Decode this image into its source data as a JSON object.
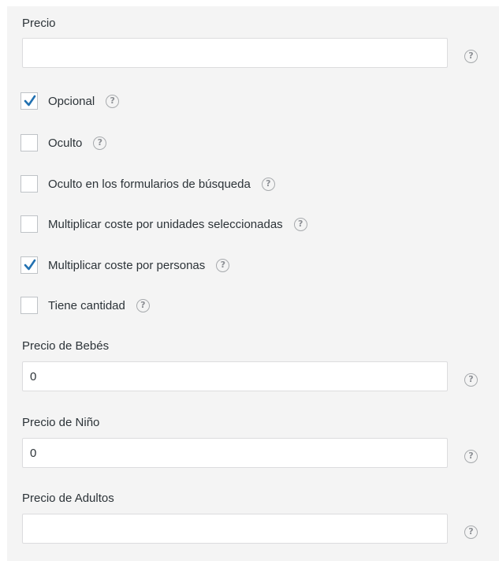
{
  "fields": {
    "precio": {
      "label": "Precio",
      "value": ""
    },
    "precio_bebes": {
      "label": "Precio de Bebés",
      "value": "0"
    },
    "precio_nino": {
      "label": "Precio de Niño",
      "value": "0"
    },
    "precio_adultos": {
      "label": "Precio de Adultos",
      "value": ""
    }
  },
  "checkboxes": [
    {
      "label": "Opcional",
      "checked": true
    },
    {
      "label": "Oculto",
      "checked": false
    },
    {
      "label": "Oculto en los formularios de búsqueda",
      "checked": false
    },
    {
      "label": "Multiplicar coste por unidades seleccionadas",
      "checked": false
    },
    {
      "label": "Multiplicar coste por personas",
      "checked": true
    },
    {
      "label": "Tiene cantidad",
      "checked": false
    }
  ],
  "help_icon": {
    "name": "question-circle-icon",
    "glyph": "?"
  },
  "colors": {
    "panel_background": "#f4f4f4",
    "check_mark": "#2271b1",
    "border": "#dcdcde"
  }
}
